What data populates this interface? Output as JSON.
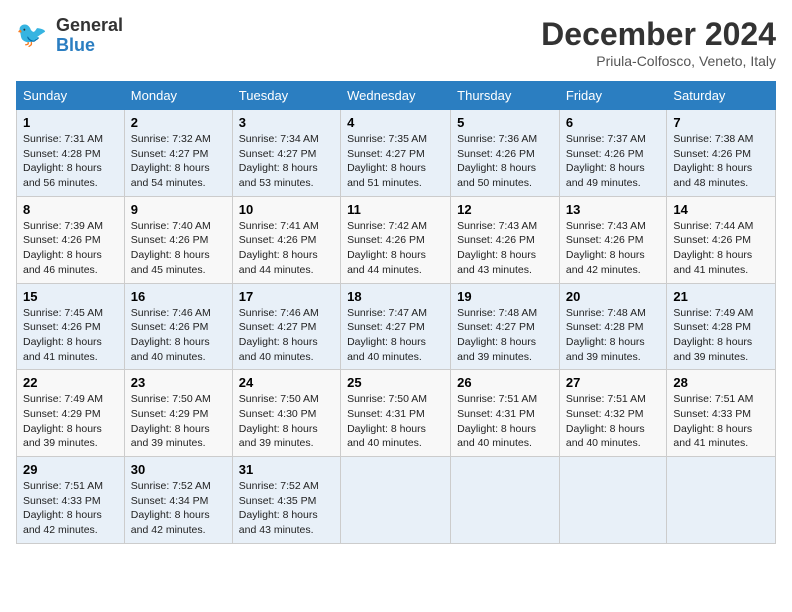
{
  "header": {
    "logo_line1": "General",
    "logo_line2": "Blue",
    "month": "December 2024",
    "location": "Priula-Colfosco, Veneto, Italy"
  },
  "days_of_week": [
    "Sunday",
    "Monday",
    "Tuesday",
    "Wednesday",
    "Thursday",
    "Friday",
    "Saturday"
  ],
  "weeks": [
    [
      {
        "day": 1,
        "sunrise": "7:31 AM",
        "sunset": "4:28 PM",
        "daylight": "8 hours and 56 minutes."
      },
      {
        "day": 2,
        "sunrise": "7:32 AM",
        "sunset": "4:27 PM",
        "daylight": "8 hours and 54 minutes."
      },
      {
        "day": 3,
        "sunrise": "7:34 AM",
        "sunset": "4:27 PM",
        "daylight": "8 hours and 53 minutes."
      },
      {
        "day": 4,
        "sunrise": "7:35 AM",
        "sunset": "4:27 PM",
        "daylight": "8 hours and 51 minutes."
      },
      {
        "day": 5,
        "sunrise": "7:36 AM",
        "sunset": "4:26 PM",
        "daylight": "8 hours and 50 minutes."
      },
      {
        "day": 6,
        "sunrise": "7:37 AM",
        "sunset": "4:26 PM",
        "daylight": "8 hours and 49 minutes."
      },
      {
        "day": 7,
        "sunrise": "7:38 AM",
        "sunset": "4:26 PM",
        "daylight": "8 hours and 48 minutes."
      }
    ],
    [
      {
        "day": 8,
        "sunrise": "7:39 AM",
        "sunset": "4:26 PM",
        "daylight": "8 hours and 46 minutes."
      },
      {
        "day": 9,
        "sunrise": "7:40 AM",
        "sunset": "4:26 PM",
        "daylight": "8 hours and 45 minutes."
      },
      {
        "day": 10,
        "sunrise": "7:41 AM",
        "sunset": "4:26 PM",
        "daylight": "8 hours and 44 minutes."
      },
      {
        "day": 11,
        "sunrise": "7:42 AM",
        "sunset": "4:26 PM",
        "daylight": "8 hours and 44 minutes."
      },
      {
        "day": 12,
        "sunrise": "7:43 AM",
        "sunset": "4:26 PM",
        "daylight": "8 hours and 43 minutes."
      },
      {
        "day": 13,
        "sunrise": "7:43 AM",
        "sunset": "4:26 PM",
        "daylight": "8 hours and 42 minutes."
      },
      {
        "day": 14,
        "sunrise": "7:44 AM",
        "sunset": "4:26 PM",
        "daylight": "8 hours and 41 minutes."
      }
    ],
    [
      {
        "day": 15,
        "sunrise": "7:45 AM",
        "sunset": "4:26 PM",
        "daylight": "8 hours and 41 minutes."
      },
      {
        "day": 16,
        "sunrise": "7:46 AM",
        "sunset": "4:26 PM",
        "daylight": "8 hours and 40 minutes."
      },
      {
        "day": 17,
        "sunrise": "7:46 AM",
        "sunset": "4:27 PM",
        "daylight": "8 hours and 40 minutes."
      },
      {
        "day": 18,
        "sunrise": "7:47 AM",
        "sunset": "4:27 PM",
        "daylight": "8 hours and 40 minutes."
      },
      {
        "day": 19,
        "sunrise": "7:48 AM",
        "sunset": "4:27 PM",
        "daylight": "8 hours and 39 minutes."
      },
      {
        "day": 20,
        "sunrise": "7:48 AM",
        "sunset": "4:28 PM",
        "daylight": "8 hours and 39 minutes."
      },
      {
        "day": 21,
        "sunrise": "7:49 AM",
        "sunset": "4:28 PM",
        "daylight": "8 hours and 39 minutes."
      }
    ],
    [
      {
        "day": 22,
        "sunrise": "7:49 AM",
        "sunset": "4:29 PM",
        "daylight": "8 hours and 39 minutes."
      },
      {
        "day": 23,
        "sunrise": "7:50 AM",
        "sunset": "4:29 PM",
        "daylight": "8 hours and 39 minutes."
      },
      {
        "day": 24,
        "sunrise": "7:50 AM",
        "sunset": "4:30 PM",
        "daylight": "8 hours and 39 minutes."
      },
      {
        "day": 25,
        "sunrise": "7:50 AM",
        "sunset": "4:31 PM",
        "daylight": "8 hours and 40 minutes."
      },
      {
        "day": 26,
        "sunrise": "7:51 AM",
        "sunset": "4:31 PM",
        "daylight": "8 hours and 40 minutes."
      },
      {
        "day": 27,
        "sunrise": "7:51 AM",
        "sunset": "4:32 PM",
        "daylight": "8 hours and 40 minutes."
      },
      {
        "day": 28,
        "sunrise": "7:51 AM",
        "sunset": "4:33 PM",
        "daylight": "8 hours and 41 minutes."
      }
    ],
    [
      {
        "day": 29,
        "sunrise": "7:51 AM",
        "sunset": "4:33 PM",
        "daylight": "8 hours and 42 minutes."
      },
      {
        "day": 30,
        "sunrise": "7:52 AM",
        "sunset": "4:34 PM",
        "daylight": "8 hours and 42 minutes."
      },
      {
        "day": 31,
        "sunrise": "7:52 AM",
        "sunset": "4:35 PM",
        "daylight": "8 hours and 43 minutes."
      },
      null,
      null,
      null,
      null
    ]
  ],
  "labels": {
    "sunrise": "Sunrise:",
    "sunset": "Sunset:",
    "daylight": "Daylight:"
  }
}
